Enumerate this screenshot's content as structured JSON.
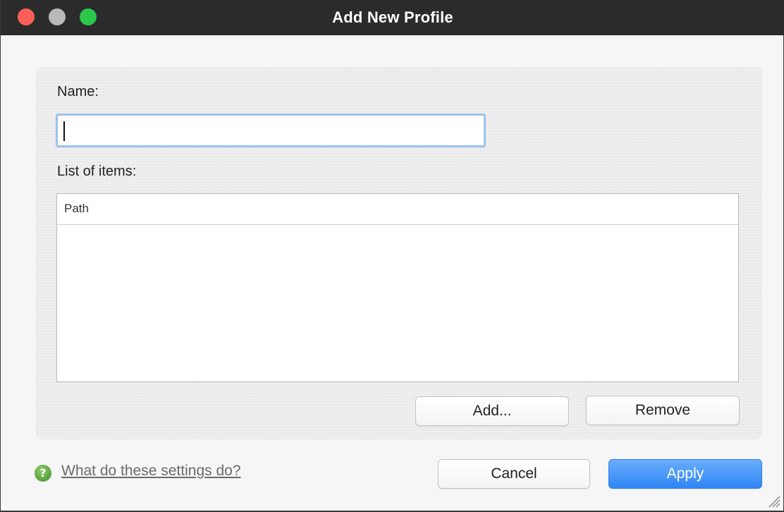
{
  "window": {
    "title": "Add New Profile"
  },
  "form": {
    "name_label": "Name:",
    "name_value": "",
    "list_label": "List of items:",
    "list_column_header": "Path",
    "list_rows": []
  },
  "buttons": {
    "add": "Add...",
    "remove": "Remove",
    "cancel": "Cancel",
    "apply": "Apply"
  },
  "help": {
    "icon": "question-icon",
    "link_text": "What do these settings do?"
  },
  "colors": {
    "accent": "#2f86f5",
    "close": "#fc5f57",
    "minimize": "#b9b9b9",
    "maximize": "#2cc84a",
    "help_icon": "#4fa03a"
  }
}
